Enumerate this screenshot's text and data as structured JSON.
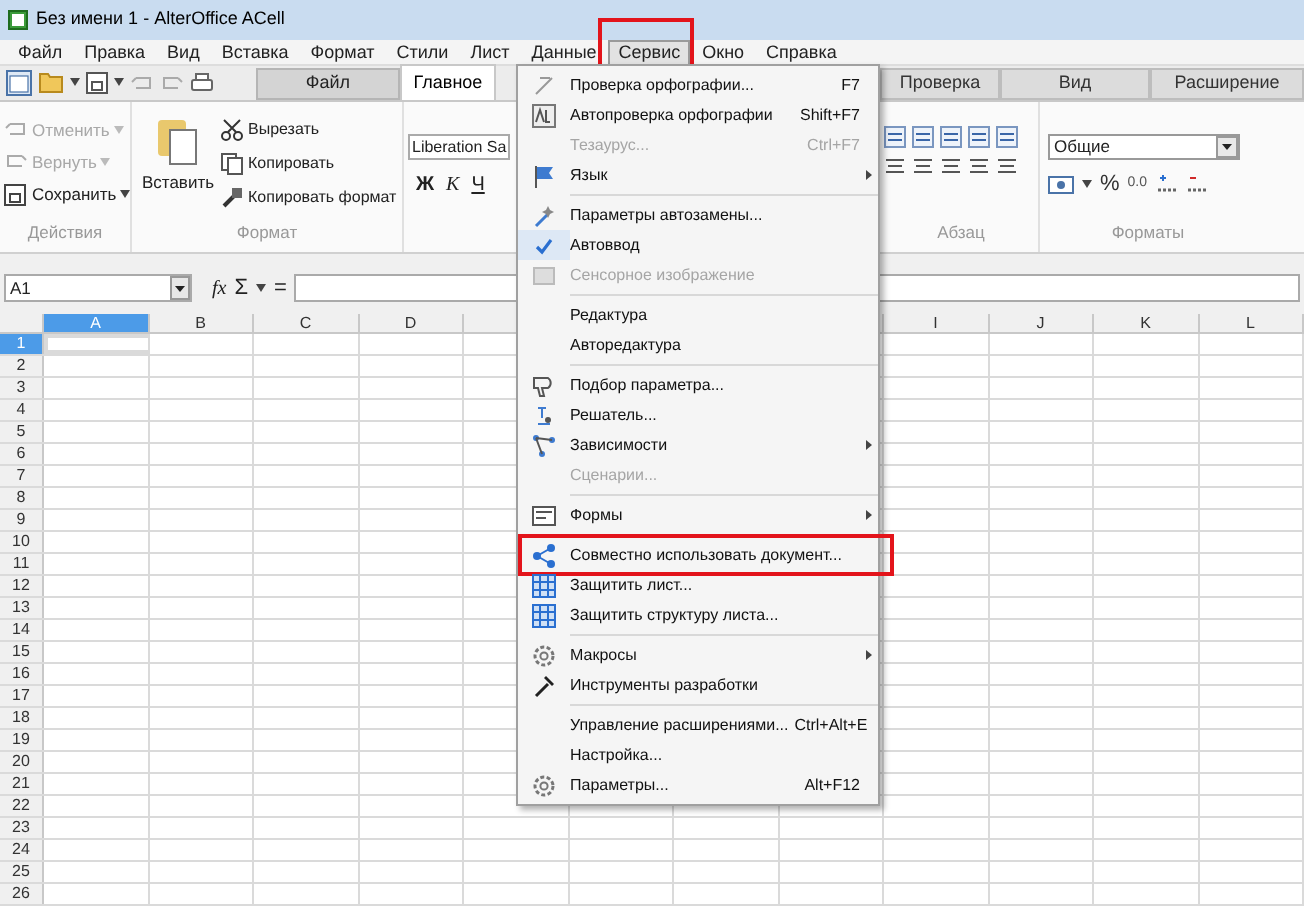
{
  "window": {
    "title": "Без имени 1 - AlterOffice ACell"
  },
  "menu_bar": [
    {
      "label": "Файл",
      "selected": false,
      "annotated": false
    },
    {
      "label": "Правка",
      "selected": false,
      "annotated": false
    },
    {
      "label": "Вид",
      "selected": false,
      "annotated": false
    },
    {
      "label": "Вставка",
      "selected": false,
      "annotated": false
    },
    {
      "label": "Формат",
      "selected": false,
      "annotated": false
    },
    {
      "label": "Стили",
      "selected": false,
      "annotated": false
    },
    {
      "label": "Лист",
      "selected": false,
      "annotated": false
    },
    {
      "label": "Данные",
      "selected": false,
      "annotated": false
    },
    {
      "label": "Сервис",
      "selected": true,
      "annotated": true
    },
    {
      "label": "Окно",
      "selected": false,
      "annotated": false
    },
    {
      "label": "Справка",
      "selected": false,
      "annotated": false
    }
  ],
  "ribbon_tabs": [
    {
      "label": "Файл",
      "kind": "file"
    },
    {
      "label": "Главное",
      "selected": true,
      "kind": "tab"
    },
    {
      "kind": "covered"
    },
    {
      "label": "Проверка",
      "selected": false,
      "kind": "tab"
    },
    {
      "label": "Вид",
      "selected": false,
      "kind": "tab"
    },
    {
      "label": "Расширение",
      "selected": false,
      "kind": "tab"
    }
  ],
  "actions_group": {
    "label": "Действия",
    "buttons": [
      {
        "label": "Отменить",
        "disabled": true,
        "kind": "undo"
      },
      {
        "label": "Вернуть",
        "disabled": true,
        "kind": "redo"
      },
      {
        "label": "Сохранить",
        "disabled": false,
        "kind": "save"
      }
    ]
  },
  "format_group": {
    "label": "Формат",
    "paste": "Вставить",
    "buttons": [
      {
        "label": "Вырезать",
        "kind": "cut"
      },
      {
        "label": "Копировать",
        "kind": "copy"
      },
      {
        "label": "Копировать формат",
        "kind": "brush"
      }
    ]
  },
  "font_group": {
    "font": "Liberation Sa",
    "styles": [
      "Ж",
      "К",
      "Ч"
    ]
  },
  "paragraph_group": {
    "label": "Абзац"
  },
  "number_group": {
    "label": "Форматы",
    "format": "Общие",
    "percent": "%",
    "decimal": "0.0"
  },
  "formula_bar": {
    "cell": "A1",
    "fx": "fx",
    "sum": "Σ",
    "equals": "="
  },
  "sheet": {
    "columns": [
      {
        "kind": "column",
        "label": "A",
        "selected": true
      },
      {
        "kind": "column",
        "label": "B",
        "selected": false
      },
      {
        "kind": "column",
        "label": "C",
        "selected": false
      },
      {
        "kind": "column",
        "label": "D",
        "selected": false
      },
      {
        "kind": "covered"
      },
      {
        "kind": "covered"
      },
      {
        "kind": "covered"
      },
      {
        "kind": "covered"
      },
      {
        "kind": "column",
        "label": "I",
        "selected": false
      },
      {
        "kind": "column",
        "label": "J",
        "selected": false
      },
      {
        "kind": "column",
        "label": "K",
        "selected": false
      },
      {
        "kind": "column",
        "label": "L",
        "selected": false
      }
    ],
    "rows": [
      {
        "label": "1",
        "selected": true
      },
      {
        "label": "2",
        "selected": false
      },
      {
        "label": "3",
        "selected": false
      },
      {
        "label": "4",
        "selected": false
      },
      {
        "label": "5",
        "selected": false
      },
      {
        "label": "6",
        "selected": false
      },
      {
        "label": "7",
        "selected": false
      },
      {
        "label": "8",
        "selected": false
      },
      {
        "label": "9",
        "selected": false
      },
      {
        "label": "10",
        "selected": false
      },
      {
        "label": "11",
        "selected": false
      },
      {
        "label": "12",
        "selected": false
      },
      {
        "label": "13",
        "selected": false
      },
      {
        "label": "14",
        "selected": false
      },
      {
        "label": "15",
        "selected": false
      },
      {
        "label": "16",
        "selected": false
      },
      {
        "label": "17",
        "selected": false
      },
      {
        "label": "18",
        "selected": false
      },
      {
        "label": "19",
        "selected": false
      },
      {
        "label": "20",
        "selected": false
      },
      {
        "label": "21",
        "selected": false
      },
      {
        "label": "22",
        "selected": false
      },
      {
        "label": "23",
        "selected": false
      },
      {
        "label": "24",
        "selected": false
      },
      {
        "label": "25",
        "selected": false
      },
      {
        "label": "26",
        "selected": false
      }
    ]
  },
  "service_menu": [
    {
      "kind": "item",
      "label": "Проверка орфографии...",
      "shortcut": "F7",
      "disabled": false,
      "checked": false,
      "submenu": false,
      "annotated": false
    },
    {
      "kind": "item",
      "label": "Автопроверка орфографии",
      "shortcut": "Shift+F7",
      "disabled": false,
      "checked": false,
      "submenu": false,
      "annotated": false
    },
    {
      "kind": "item",
      "label": "Тезаурус...",
      "shortcut": "Ctrl+F7",
      "disabled": true,
      "checked": false,
      "submenu": false,
      "annotated": false
    },
    {
      "kind": "item",
      "label": "Язык",
      "disabled": false,
      "checked": false,
      "submenu": true,
      "annotated": false
    },
    {
      "kind": "separator"
    },
    {
      "kind": "item",
      "label": "Параметры автозамены...",
      "disabled": false,
      "checked": false,
      "submenu": false,
      "annotated": false
    },
    {
      "kind": "item",
      "label": "Автоввод",
      "disabled": false,
      "checked": true,
      "submenu": false,
      "annotated": false
    },
    {
      "kind": "item",
      "label": "Сенсорное изображение",
      "disabled": true,
      "checked": false,
      "submenu": false,
      "annotated": false
    },
    {
      "kind": "separator"
    },
    {
      "kind": "item",
      "label": "Редактура",
      "disabled": false,
      "checked": false,
      "submenu": false,
      "annotated": false
    },
    {
      "kind": "item",
      "label": "Авторедактура",
      "disabled": false,
      "checked": false,
      "submenu": false,
      "annotated": false
    },
    {
      "kind": "separator"
    },
    {
      "kind": "item",
      "label": "Подбор параметра...",
      "disabled": false,
      "checked": false,
      "submenu": false,
      "annotated": false
    },
    {
      "kind": "item",
      "label": "Решатель...",
      "disabled": false,
      "checked": false,
      "submenu": false,
      "annotated": false
    },
    {
      "kind": "item",
      "label": "Зависимости",
      "disabled": false,
      "checked": false,
      "submenu": true,
      "annotated": false
    },
    {
      "kind": "item",
      "label": "Сценарии...",
      "disabled": true,
      "checked": false,
      "submenu": false,
      "annotated": false
    },
    {
      "kind": "separator"
    },
    {
      "kind": "item",
      "label": "Формы",
      "disabled": false,
      "checked": false,
      "submenu": true,
      "annotated": false
    },
    {
      "kind": "separator"
    },
    {
      "kind": "item",
      "label": "Совместно использовать документ...",
      "disabled": false,
      "checked": false,
      "submenu": false,
      "annotated": true
    },
    {
      "kind": "item",
      "label": "Защитить лист...",
      "disabled": false,
      "checked": false,
      "submenu": false,
      "annotated": false
    },
    {
      "kind": "item",
      "label": "Защитить структуру листа...",
      "disabled": false,
      "checked": false,
      "submenu": false,
      "annotated": false
    },
    {
      "kind": "separator"
    },
    {
      "kind": "item",
      "label": "Макросы",
      "disabled": false,
      "checked": false,
      "submenu": true,
      "annotated": false
    },
    {
      "kind": "item",
      "label": "Инструменты разработки",
      "disabled": false,
      "checked": false,
      "submenu": false,
      "annotated": false
    },
    {
      "kind": "separator"
    },
    {
      "kind": "item",
      "label": "Управление расширениями...",
      "shortcut": "Ctrl+Alt+E",
      "disabled": false,
      "checked": false,
      "submenu": false,
      "annotated": false
    },
    {
      "kind": "item",
      "label": "Настройка...",
      "disabled": false,
      "checked": false,
      "submenu": false,
      "annotated": false
    },
    {
      "kind": "item",
      "label": "Параметры...",
      "shortcut": "Alt+F12",
      "disabled": false,
      "checked": false,
      "submenu": false,
      "annotated": false
    }
  ]
}
